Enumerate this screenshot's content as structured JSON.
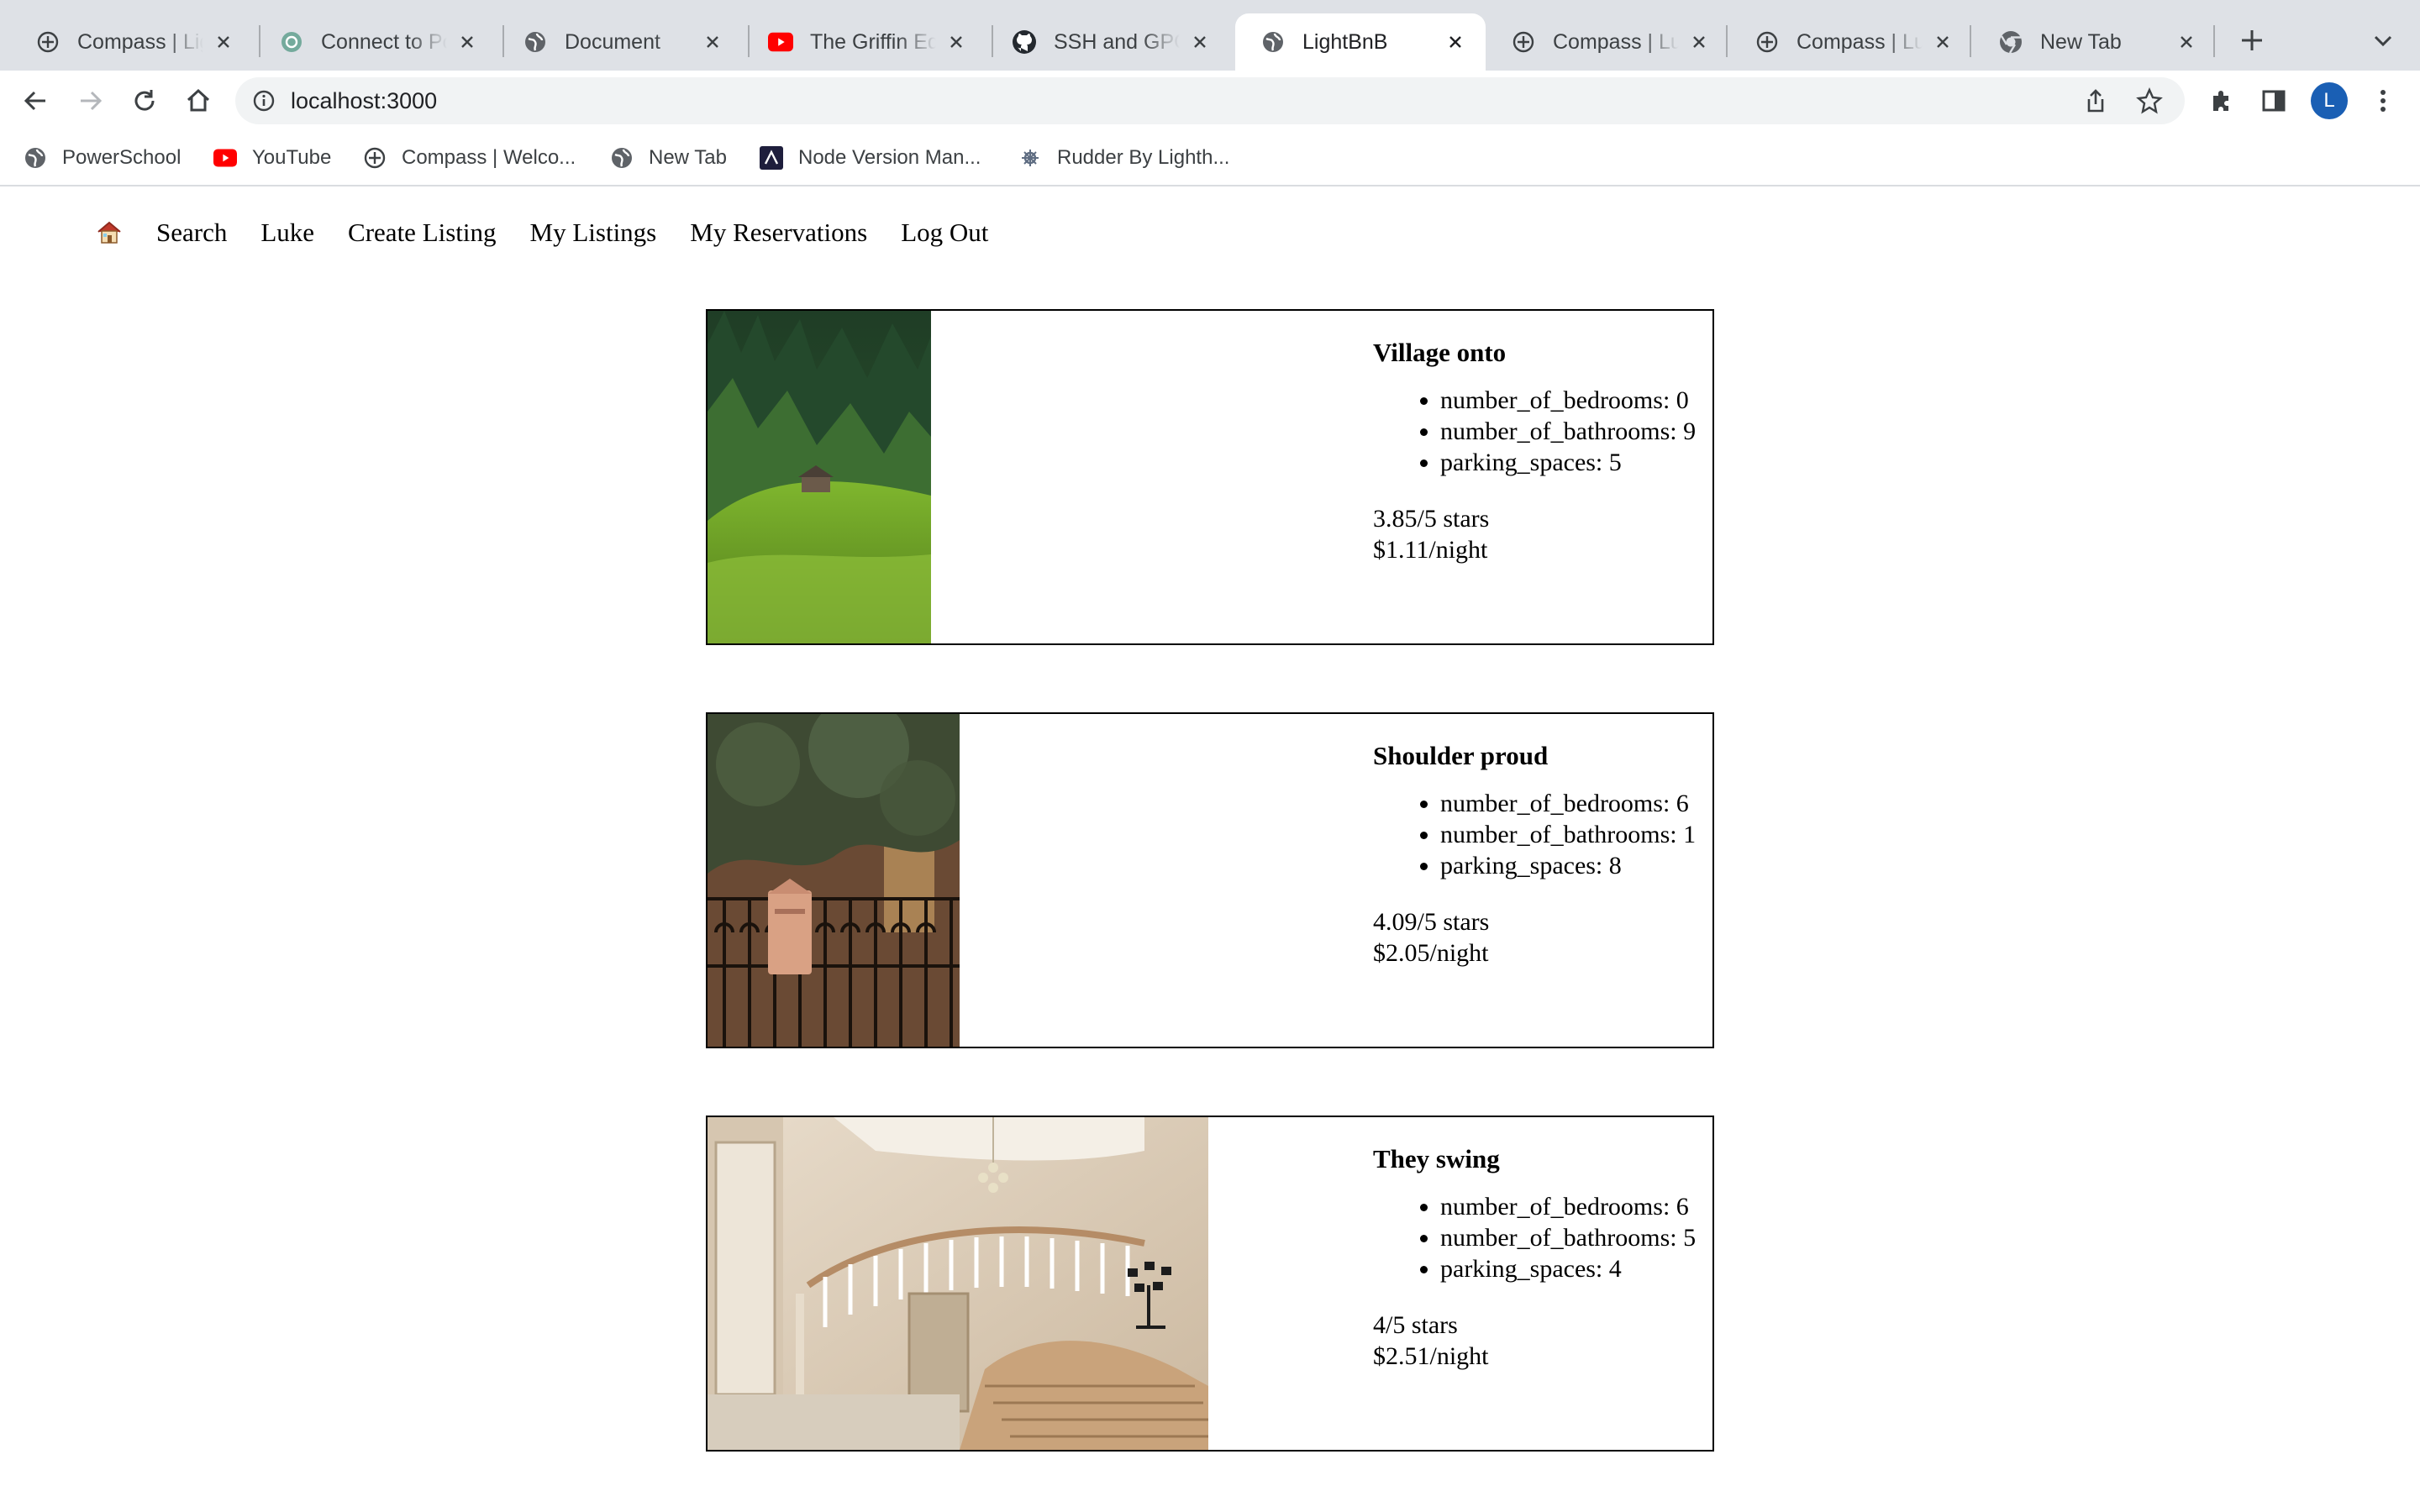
{
  "browser": {
    "tabs": [
      {
        "title": "Compass | Lighthouse Labs",
        "icon": "compass-icon"
      },
      {
        "title": "Connect to Postgres",
        "icon": "chatgpt-icon"
      },
      {
        "title": "Document",
        "icon": "globe-icon"
      },
      {
        "title": "The Griffin Equation",
        "icon": "youtube-icon"
      },
      {
        "title": "SSH and GPG keys",
        "icon": "github-icon"
      },
      {
        "title": "LightBnB",
        "icon": "globe-icon",
        "active": true
      },
      {
        "title": "Compass | Luke",
        "icon": "compass-icon"
      },
      {
        "title": "Compass | Luke",
        "icon": "compass-icon"
      },
      {
        "title": "New Tab",
        "icon": "chrome-icon"
      }
    ],
    "url": "localhost:3000",
    "profile_initial": "L",
    "bookmarks": [
      {
        "label": "PowerSchool",
        "icon": "globe-icon"
      },
      {
        "label": "YouTube",
        "icon": "youtube-icon"
      },
      {
        "label": "Compass | Welco...",
        "icon": "compass-icon"
      },
      {
        "label": "New Tab",
        "icon": "globe-icon"
      },
      {
        "label": "Node Version Man...",
        "icon": "nvm-icon"
      },
      {
        "label": "Rudder By Lighth...",
        "icon": "rudder-icon"
      }
    ]
  },
  "nav": {
    "home_icon": "🏠",
    "links": [
      "Search",
      "Luke",
      "Create Listing",
      "My Listings",
      "My Reservations",
      "Log Out"
    ]
  },
  "listings": [
    {
      "title": "Village onto",
      "bedrooms": "number_of_bedrooms: 0",
      "bathrooms": "number_of_bathrooms: 9",
      "parking": "parking_spaces: 5",
      "rating": "3.85/5 stars",
      "price": "$1.11/night",
      "image": "forest-cabin-photo"
    },
    {
      "title": "Shoulder proud",
      "bedrooms": "number_of_bedrooms: 6",
      "bathrooms": "number_of_bathrooms: 1",
      "parking": "parking_spaces: 8",
      "rating": "4.09/5 stars",
      "price": "$2.05/night",
      "image": "gate-mailbox-photo"
    },
    {
      "title": "They swing",
      "bedrooms": "number_of_bedrooms: 6",
      "bathrooms": "number_of_bathrooms: 5",
      "parking": "parking_spaces: 4",
      "rating": "4/5 stars",
      "price": "$2.51/night",
      "image": "staircase-foyer-photo"
    }
  ]
}
